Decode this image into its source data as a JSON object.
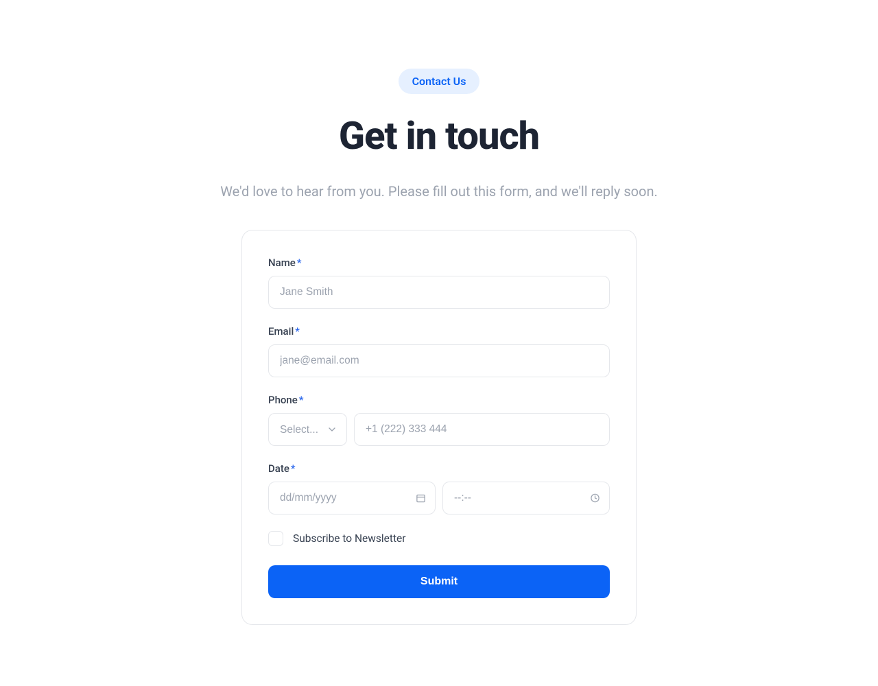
{
  "header": {
    "badge": "Contact Us",
    "title": "Get in touch",
    "subtitle": "We'd love to hear from you. Please fill out this form, and we'll reply soon."
  },
  "form": {
    "name": {
      "label": "Name",
      "required": "*",
      "placeholder": "Jane Smith"
    },
    "email": {
      "label": "Email",
      "required": "*",
      "placeholder": "jane@email.com"
    },
    "phone": {
      "label": "Phone",
      "required": "*",
      "select_placeholder": "Select...",
      "placeholder": "+1 (222) 333 444"
    },
    "date": {
      "label": "Date",
      "required": "*",
      "date_placeholder": "dd/mm/yyyy",
      "time_placeholder": "--:--"
    },
    "newsletter": {
      "label": "Subscribe to Newsletter"
    },
    "submit": "Submit"
  }
}
